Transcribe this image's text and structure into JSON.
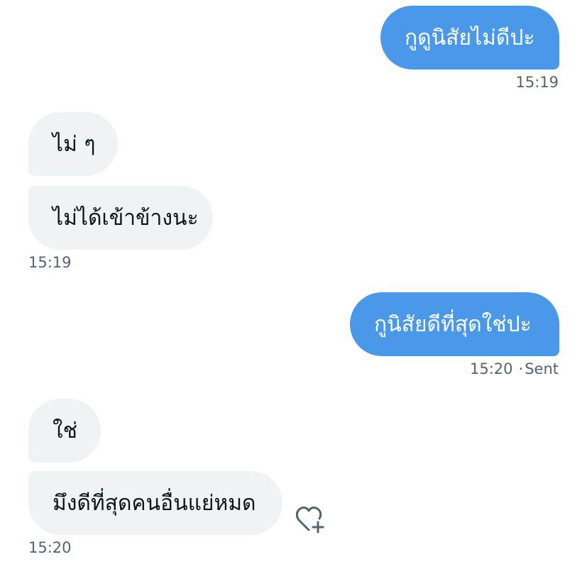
{
  "messages": [
    {
      "id": "m1",
      "text": "กูดูนิสัยไม่ดีปะ",
      "direction": "outgoing"
    },
    {
      "id": "m2",
      "text": "ไม่ ๆ",
      "direction": "incoming"
    },
    {
      "id": "m3",
      "text": "ไม่ได้เข้าข้างนะ",
      "direction": "incoming"
    },
    {
      "id": "m4",
      "text": "กูนิสัยดีที่สุดใช่ปะ",
      "direction": "outgoing"
    },
    {
      "id": "m5",
      "text": "ใช่",
      "direction": "incoming"
    },
    {
      "id": "m6",
      "text": "มึงดีที่สุดคนอื่นแย่หมด",
      "direction": "incoming"
    }
  ],
  "timestamps": {
    "t1": "15:19",
    "t2": "15:19",
    "t3": "15:20",
    "t3_status": "Sent",
    "t3_separator": "·",
    "t4": "15:20"
  },
  "icons": {
    "react": "heart-plus-icon"
  },
  "colors": {
    "outgoing_bubble": "#4a99e9",
    "incoming_bubble": "#eff3f4",
    "timestamp": "#536471"
  }
}
